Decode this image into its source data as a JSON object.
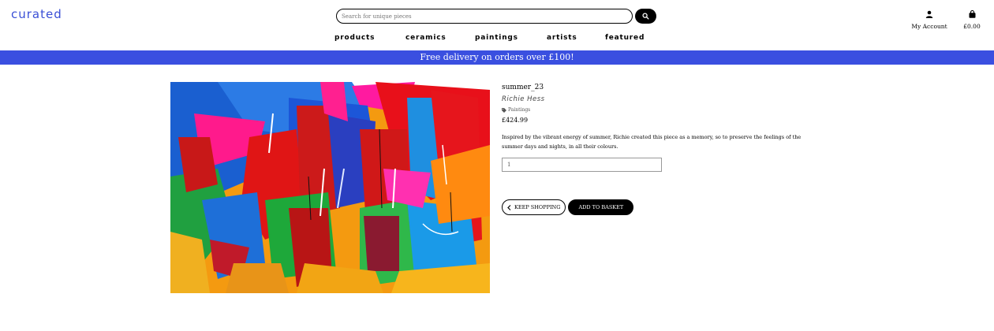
{
  "header": {
    "logo": "curated",
    "search": {
      "placeholder": "Search for unique pieces",
      "value": ""
    },
    "account_label": "My Account",
    "basket_total": "£0.00"
  },
  "nav": {
    "items": [
      "products",
      "ceramics",
      "paintings",
      "artists",
      "featured"
    ]
  },
  "banner": {
    "text": "Free delivery on orders over £100!"
  },
  "product": {
    "title": "summer_23",
    "artist": "Richie Hess",
    "category": "Paintings",
    "price": "£424.99",
    "description": "Inspired by the vibrant energy of summer, Richie created this piece as a memory, so to preserve the feelings of the summer days and nights, in all their colours.",
    "quantity": "1",
    "keep_shopping_label": "KEEP SHOPPING",
    "add_to_basket_label": "ADD TO BASKET"
  },
  "colors": {
    "brand": "#3a4fd6",
    "banner": "#3a4fe0"
  }
}
